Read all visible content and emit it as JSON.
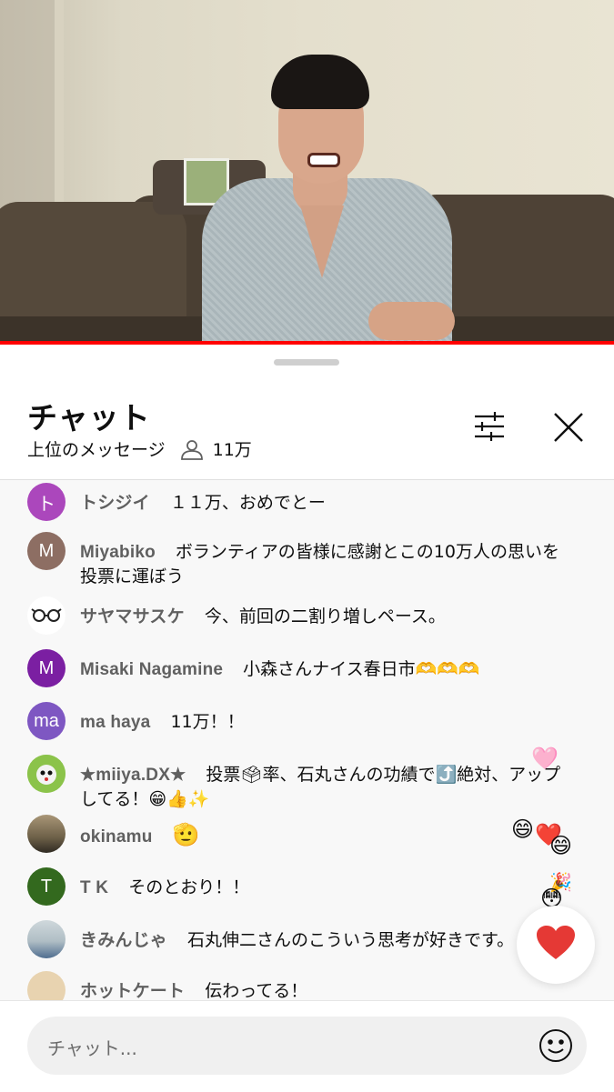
{
  "chat": {
    "title": "チャット",
    "mode_label": "上位のメッセージ",
    "viewer_count": "11万",
    "input_placeholder": "チャット..."
  },
  "messages": [
    {
      "author": "トシジイ",
      "text": "１１万、おめでとー",
      "avatar_letter": "ト",
      "avatar_color": "#ab47bc"
    },
    {
      "author": "Miyabiko",
      "text": "ボランティアの皆様に感謝とこの10万人の思いを投票に運ぼう",
      "avatar_letter": "M",
      "avatar_color": "#8d6e63"
    },
    {
      "author": "サヤマサスケ",
      "text": "今、前回の二割り増しペース。",
      "avatar_letter": "",
      "avatar_color": "#ffffff"
    },
    {
      "author": "Misaki Nagamine",
      "text": "小森さんナイス春日市🫶🫶🫶",
      "avatar_letter": "M",
      "avatar_color": "#7b1fa2"
    },
    {
      "author": "ma haya",
      "text": "11万！！",
      "avatar_letter": "ma",
      "avatar_color": "#7e57c2"
    },
    {
      "author": "★miiya.DX★",
      "text": "投票🗳率、石丸さんの功績で⤴️絶対、アップしてる！😁👍✨",
      "avatar_letter": "",
      "avatar_color": "#9ccc65"
    },
    {
      "author": "okinamu",
      "text": "🫡",
      "avatar_letter": "",
      "avatar_color": "#8d7b5e"
    },
    {
      "author": "T K",
      "text": "そのとおり！！",
      "avatar_letter": "T",
      "avatar_color": "#33691e"
    },
    {
      "author": "きみんじゃ",
      "text": "石丸伸二さんのこういう思考が好きです。",
      "avatar_letter": "",
      "avatar_color": "#90a4ae"
    },
    {
      "author": "ホットケート",
      "text": "伝わってる！",
      "avatar_letter": "",
      "avatar_color": "#e8d3b0"
    }
  ],
  "reactions": [
    "🩷",
    "😄",
    "❤️",
    "😄",
    "🎉",
    "😳",
    "❤️"
  ],
  "icons": {
    "filter": "sliders-icon",
    "close": "close-icon",
    "viewer": "person-icon",
    "emoji": "smiley-icon",
    "heart": "heart-icon"
  },
  "colors": {
    "progress": "#ff0000",
    "heart": "#e53935",
    "author": "#606060"
  }
}
